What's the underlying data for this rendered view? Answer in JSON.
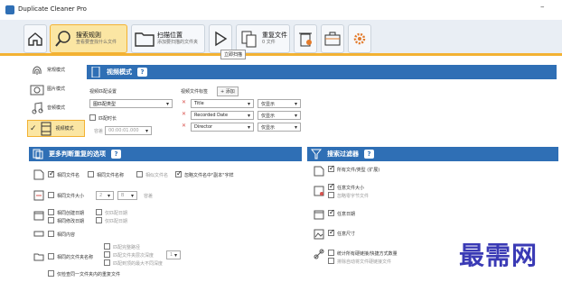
{
  "app": {
    "title": "Duplicate Cleaner Pro",
    "minimize": "–"
  },
  "ribbon": {
    "home_icon": "home-icon",
    "search_rules": {
      "label": "搜索规则",
      "sub": "查看要查找什么文件",
      "icon": "search-icon"
    },
    "scan_location": {
      "label": "扫描位置",
      "sub": "添加要扫描的文件夹",
      "icon": "folder-icon"
    },
    "start_scan": {
      "icon": "play-icon",
      "tooltip": "立即扫描"
    },
    "duplicate_files": {
      "label": "重复文件",
      "sub": "0 文件",
      "icon": "duplicate-files-icon"
    },
    "delete_icon": "trash-icon",
    "export_icon": "toolbox-icon",
    "settings_icon": "gear-icon"
  },
  "modes": [
    {
      "label": "常规模式",
      "icon": "fingerprint-icon"
    },
    {
      "label": "图片模式",
      "icon": "camera-icon"
    },
    {
      "label": "音频模式",
      "icon": "music-icon"
    },
    {
      "label": "视频模式",
      "icon": "film-icon"
    }
  ],
  "video": {
    "header": "视频模式",
    "match_settings_label": "视频匹配设置",
    "match_type": "图匹配类型",
    "compare_duration": "匹配时长",
    "tolerance_label": "容差",
    "tolerance_value": "00:00:01.000",
    "tags_label": "视频文件标签",
    "add_button": "+ 添加",
    "tags": [
      {
        "name": "Title",
        "mode": "仅显示"
      },
      {
        "name": "Recorded Date",
        "mode": "仅显示"
      },
      {
        "name": "Director",
        "mode": "仅显示"
      }
    ]
  },
  "more_options": {
    "header": "更多判断重复的选项",
    "same_filename": "相同文件名",
    "same_name_part": "相同文件名称",
    "similar_filename": "相似文件名",
    "ignore_numbers": "忽略文件名中\"副本\"字样",
    "same_size": "相同文件大小",
    "size_value": "2",
    "size_unit": "B",
    "size_tolerance": "容差",
    "same_created": "相同创建日期",
    "same_modified": "相同修改日期",
    "only_date_created": "仅匹配日期",
    "only_date_modified": "仅匹配日期",
    "same_content": "相同内容",
    "same_folder_name": "相同的文件夹名称",
    "folder_opt1": "匹配完整路径",
    "folder_opt2": "匹配文件夹层次深度",
    "folder_depth": "1",
    "folder_opt3": "匹配到顶的最大不同深度",
    "same_single_file": "仅检查同一文件夹内的重复文件"
  },
  "filters": {
    "header": "搜索过滤器",
    "file_type": "所有文件/类型 (扩展)",
    "file_size": "任意文件大小",
    "include_zero": "忽略零字节文件",
    "dates": "任意日期",
    "dimensions": "任意尺寸",
    "hardlinks": "统计所有硬链接/快捷方式数量",
    "exclude_links": "排除自动将文件硬链接文件"
  },
  "watermark": "最需网"
}
